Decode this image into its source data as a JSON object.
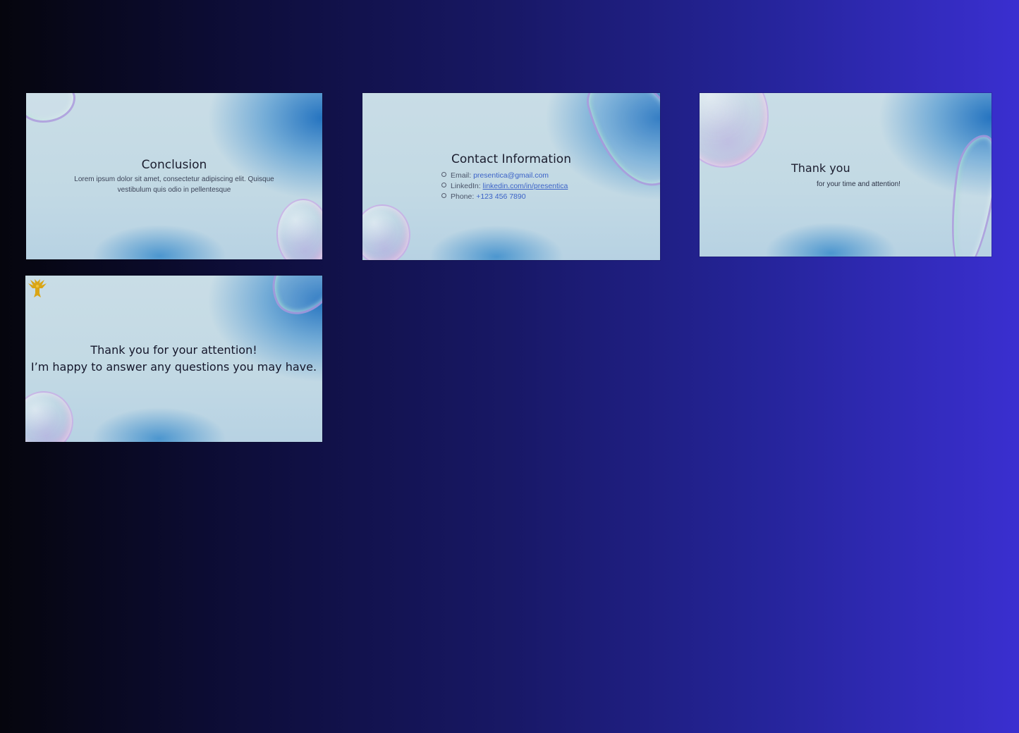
{
  "slides": [
    {
      "title": "Conclusion",
      "body": "Lorem ipsum dolor sit amet, consectetur adipiscing elit. Quisque vestibulum quis odio in pellentesque"
    },
    {
      "title": "Contact Information",
      "contacts": [
        {
          "label": "Email: ",
          "value": "presentica@gmail.com"
        },
        {
          "label": "LinkedIn: ",
          "value": "linkedin.com/in/presentica"
        },
        {
          "label": "Phone: ",
          "value": "+123 456 7890"
        }
      ]
    },
    {
      "title": "Thank you",
      "subtitle": "for your time and attention!"
    },
    {
      "line1": "Thank you for your attention!",
      "line2": "I’m happy to answer any questions you may have.",
      "logo_icon": "eagle-logo-icon"
    }
  ],
  "colors": {
    "link": "#3c63c7",
    "logo": "#d9a516"
  }
}
